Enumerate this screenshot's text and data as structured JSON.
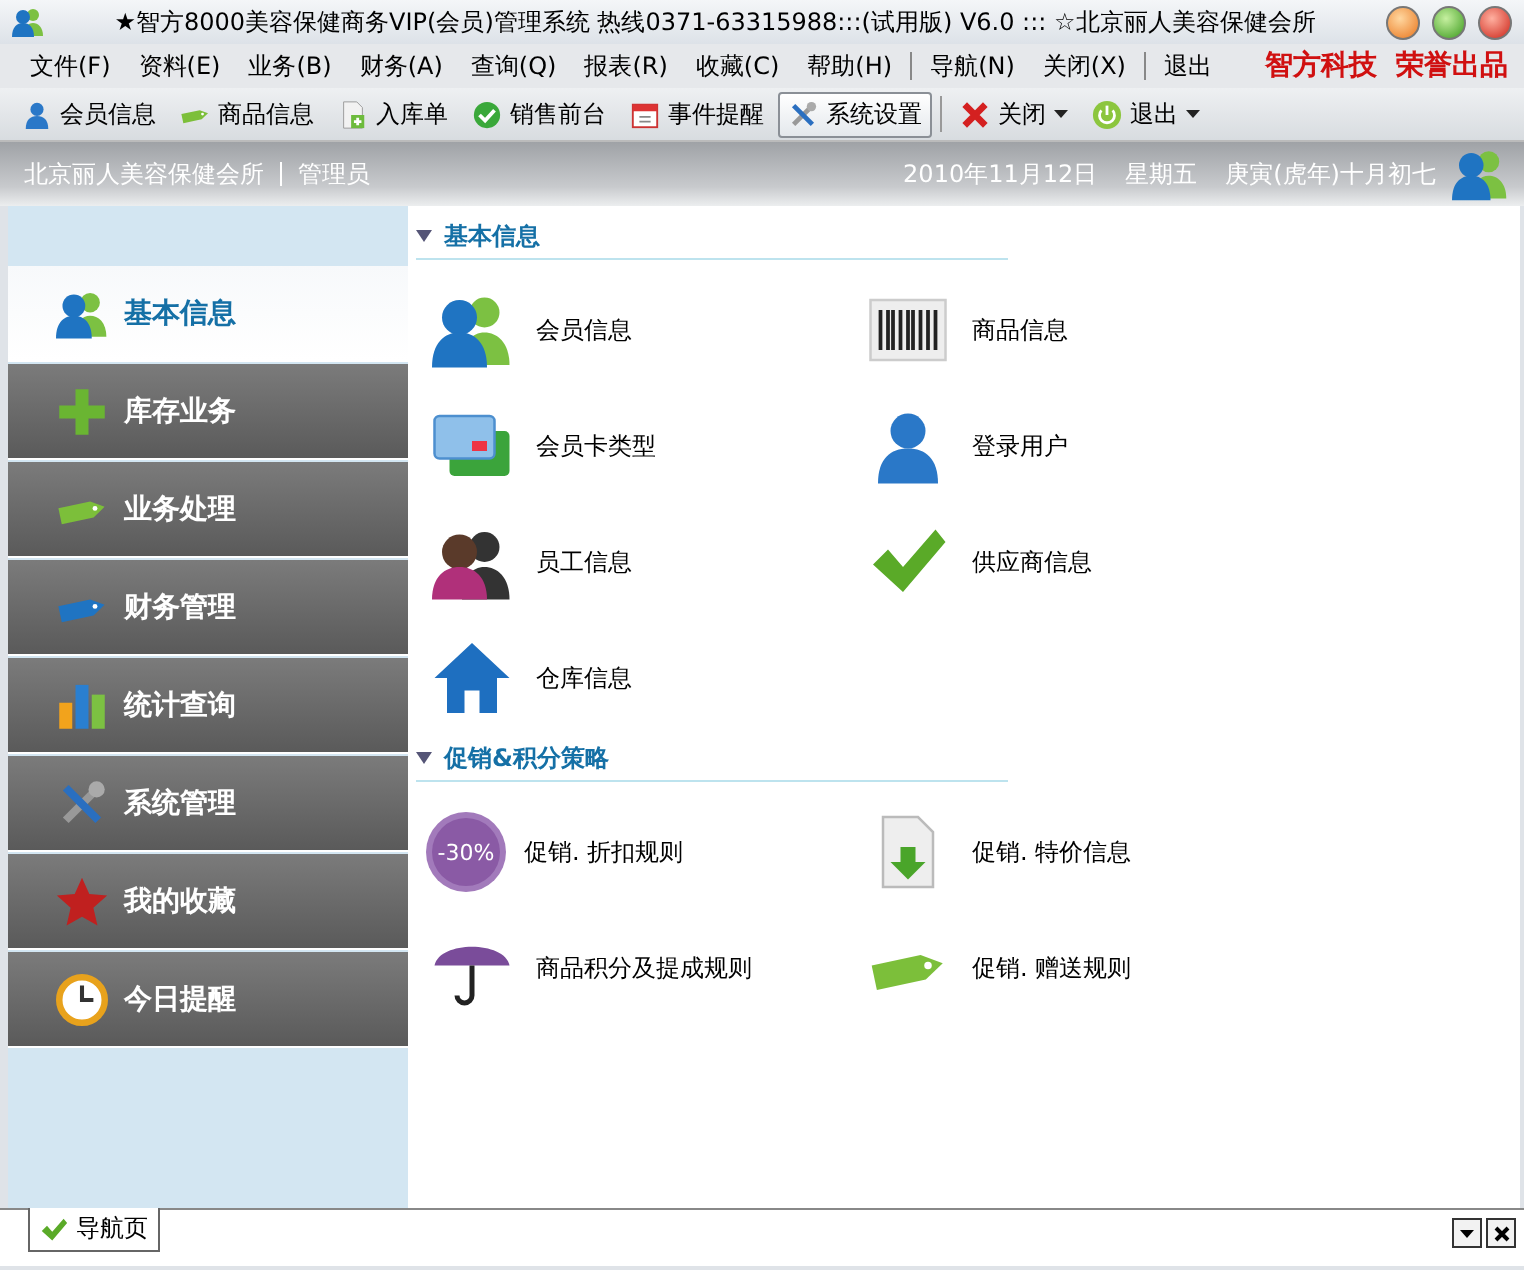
{
  "window": {
    "title": "★智方8000美容保健商务VIP(会员)管理系统 热线0371-63315988:::(试用版) V6.0 ::: ☆北京丽人美容保健会所"
  },
  "menu": {
    "items": [
      {
        "label": "文件(F)"
      },
      {
        "label": "资料(E)"
      },
      {
        "label": "业务(B)"
      },
      {
        "label": "财务(A)"
      },
      {
        "label": "查询(Q)"
      },
      {
        "label": "报表(R)"
      },
      {
        "label": "收藏(C)"
      },
      {
        "label": "帮助(H)"
      },
      {
        "label": "导航(N)"
      },
      {
        "label": "关闭(X)"
      },
      {
        "label": "退出"
      }
    ],
    "brand": "智方科技  荣誉出品"
  },
  "toolbar": [
    {
      "label": "会员信息",
      "selected": false,
      "dropdown": false
    },
    {
      "label": "商品信息",
      "selected": false,
      "dropdown": false
    },
    {
      "label": "入库单",
      "selected": false,
      "dropdown": false
    },
    {
      "label": "销售前台",
      "selected": false,
      "dropdown": false
    },
    {
      "label": "事件提醒",
      "selected": false,
      "dropdown": false
    },
    {
      "label": "系统设置",
      "selected": true,
      "dropdown": false
    },
    {
      "label": "关闭",
      "selected": false,
      "dropdown": true
    },
    {
      "label": "退出",
      "selected": false,
      "dropdown": true
    }
  ],
  "header": {
    "org": "北京丽人美容保健会所",
    "role": "管理员",
    "date": "2010年11月12日",
    "weekday": "星期五",
    "lunar": "庚寅(虎年)十月初七"
  },
  "sidebar": {
    "items": [
      {
        "label": "基本信息",
        "selected": true
      },
      {
        "label": "库存业务",
        "selected": false
      },
      {
        "label": "业务处理",
        "selected": false
      },
      {
        "label": "财务管理",
        "selected": false
      },
      {
        "label": "统计查询",
        "selected": false
      },
      {
        "label": "系统管理",
        "selected": false
      },
      {
        "label": "我的收藏",
        "selected": false
      },
      {
        "label": "今日提醒",
        "selected": false
      }
    ]
  },
  "sections": [
    {
      "title": "基本信息",
      "expanded": true,
      "items": [
        {
          "label": "会员信息"
        },
        {
          "label": "商品信息"
        },
        {
          "label": "会员卡类型"
        },
        {
          "label": "登录用户"
        },
        {
          "label": "员工信息"
        },
        {
          "label": "供应商信息"
        },
        {
          "label": "仓库信息"
        }
      ]
    },
    {
      "title": "促销&积分策略",
      "expanded": true,
      "items": [
        {
          "label": "促销. 折扣规则",
          "badge": "-30%"
        },
        {
          "label": "促销. 特价信息"
        },
        {
          "label": "商品积分及提成规则"
        },
        {
          "label": "促销. 赠送规则"
        }
      ]
    }
  ],
  "tabs": [
    {
      "label": "导航页",
      "selected": true
    }
  ]
}
